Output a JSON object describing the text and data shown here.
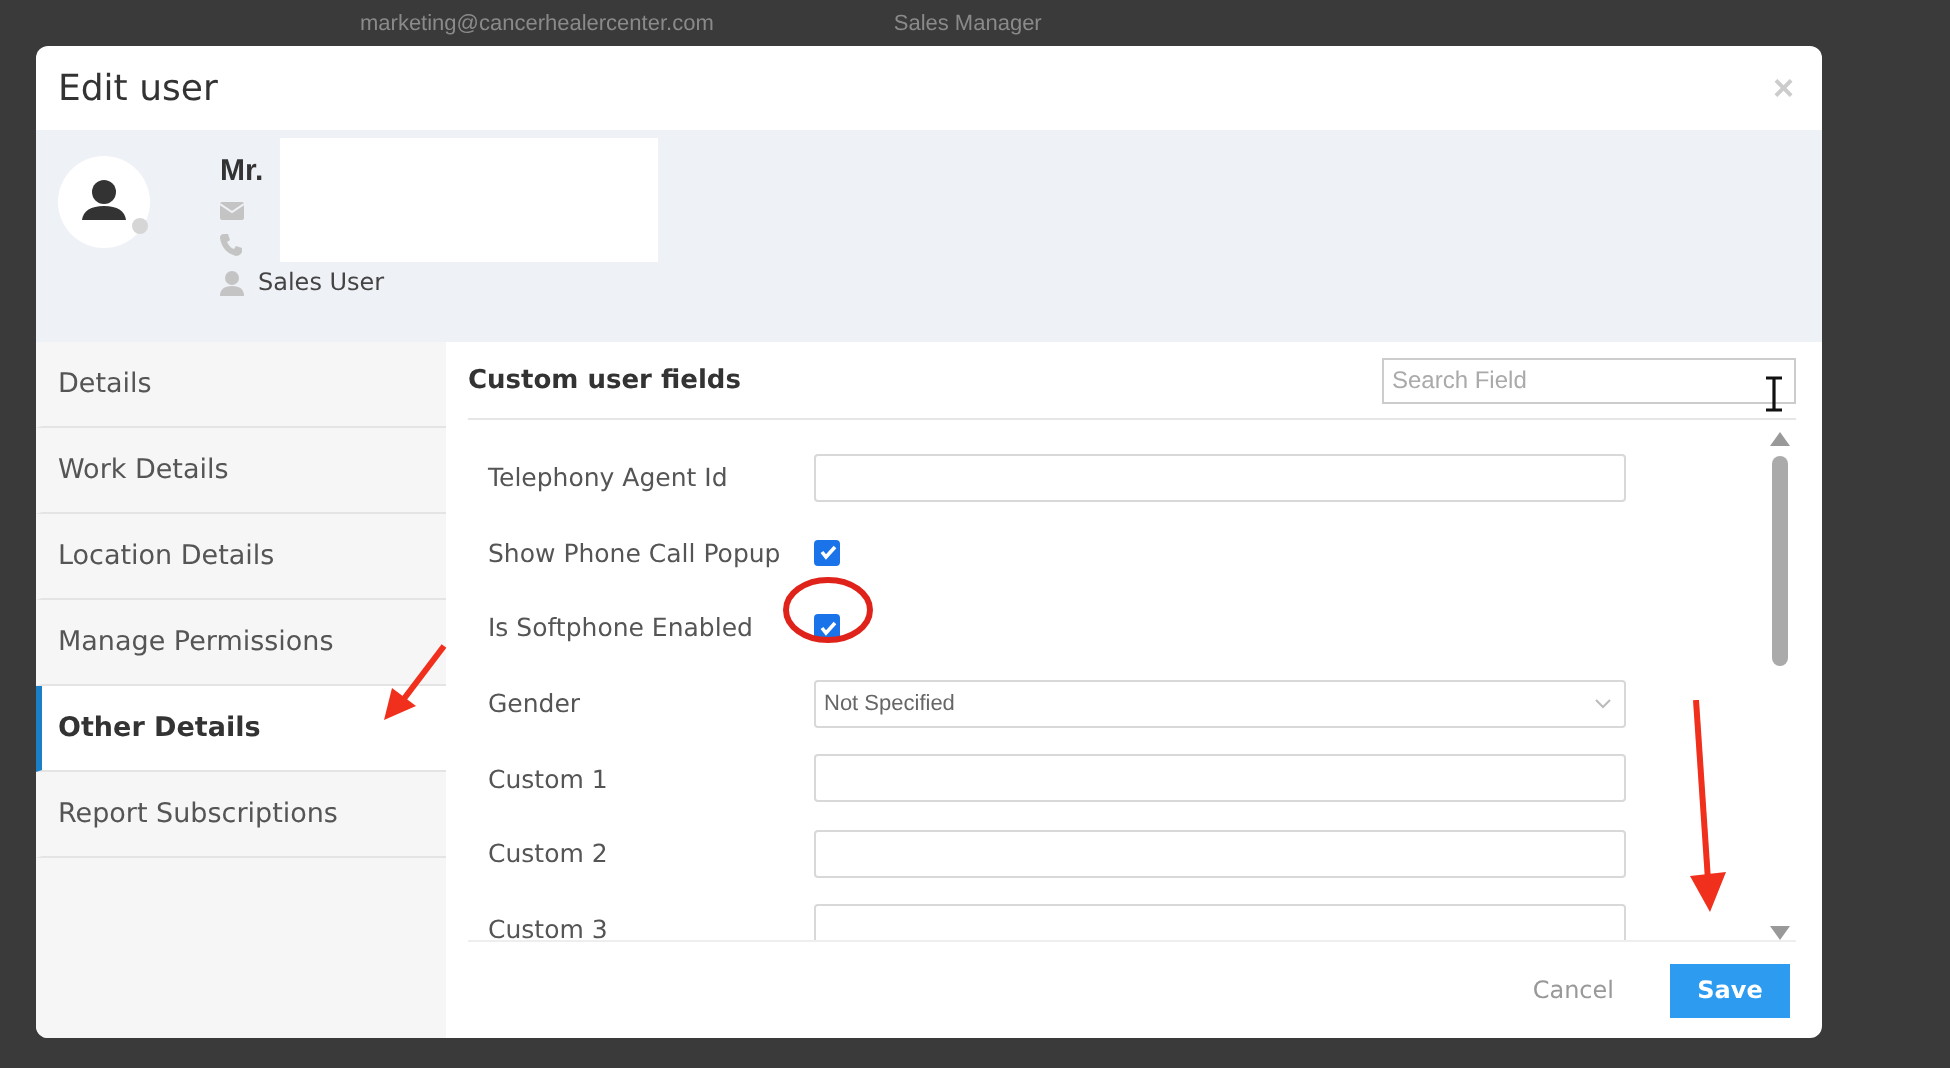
{
  "background": {
    "texts": [
      "marketing@cancerhealercenter.com",
      "Sales Manager"
    ]
  },
  "dialog": {
    "title": "Edit user",
    "close": "×"
  },
  "profile": {
    "name": "Mr.",
    "role": "Sales User"
  },
  "sidebar": {
    "items": [
      {
        "label": "Details",
        "selected": false
      },
      {
        "label": "Work Details",
        "selected": false
      },
      {
        "label": "Location Details",
        "selected": false
      },
      {
        "label": "Manage Permissions",
        "selected": false
      },
      {
        "label": "Other Details",
        "selected": true
      },
      {
        "label": "Report Subscriptions",
        "selected": false
      }
    ]
  },
  "panel": {
    "title": "Custom user fields",
    "search": {
      "placeholder": "Search Field"
    },
    "fields": [
      {
        "label": "Telephony Agent Id",
        "kind": "text"
      },
      {
        "label": "Show Phone Call Popup",
        "kind": "checkbox",
        "checked": true
      },
      {
        "label": "Is Softphone Enabled",
        "kind": "checkbox",
        "checked": true
      },
      {
        "label": "Gender",
        "kind": "select",
        "value": "Not Specified"
      },
      {
        "label": "Custom 1",
        "kind": "text"
      },
      {
        "label": "Custom 2",
        "kind": "text"
      },
      {
        "label": "Custom 3",
        "kind": "text"
      }
    ]
  },
  "footer": {
    "buttons": [
      "Cancel",
      "Save"
    ]
  }
}
